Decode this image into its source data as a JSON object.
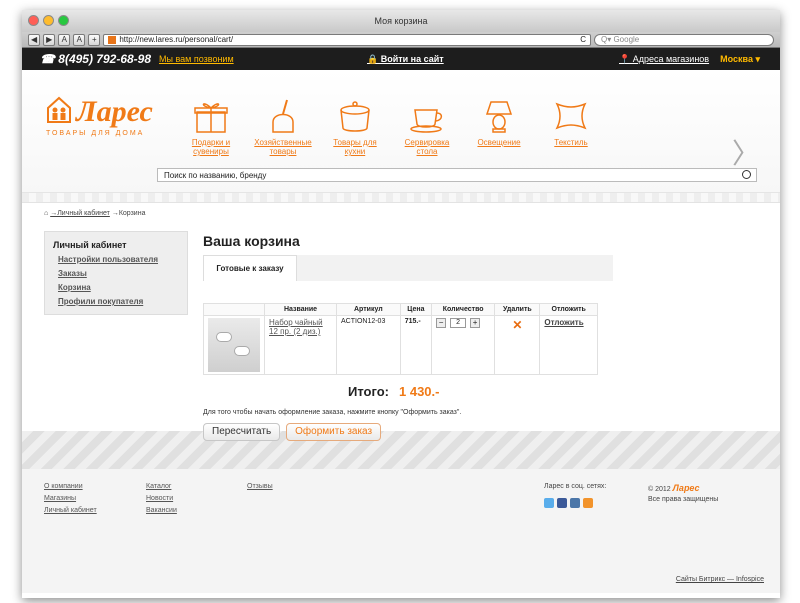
{
  "window": {
    "title": "Моя корзина"
  },
  "browser": {
    "url": "http://new.lares.ru/personal/cart/",
    "search_placeholder": "Q▾ Google",
    "font_smaller": "A",
    "font_larger": "A",
    "back": "◀",
    "forward": "▶",
    "add": "+",
    "reload": "C"
  },
  "topbar": {
    "phone": "☎ 8(495) 792-68-98",
    "callback": "Мы вам позвоним",
    "login": "🔒 Войти на сайт",
    "stores": "📍 Адреса магазинов",
    "city": "Москва ▾"
  },
  "logo": {
    "name": "Ларес",
    "subtitle": "ТОВАРЫ ДЛЯ ДОМА"
  },
  "categories": [
    {
      "label": "Подарки и сувениры",
      "icon": "gift-icon"
    },
    {
      "label": "Хозяйственные товары",
      "icon": "dustpan-icon"
    },
    {
      "label": "Товары для кухни",
      "icon": "pot-icon"
    },
    {
      "label": "Сервировка стола",
      "icon": "teacup-icon"
    },
    {
      "label": "Освещение",
      "icon": "lamp-icon"
    },
    {
      "label": "Текстиль",
      "icon": "pillow-icon"
    }
  ],
  "search": {
    "placeholder": "Поиск по названию, бренду"
  },
  "breadcrumb": [
    "⌂",
    "→Личный кабинет",
    "→Корзина"
  ],
  "sidebar": {
    "title": "Личный кабинет",
    "items": [
      "Настройки пользователя",
      "Заказы",
      "Корзина",
      "Профили покупателя"
    ]
  },
  "cart": {
    "title": "Ваша корзина",
    "tab": "Готовые к заказу",
    "columns": [
      "Название",
      "Артикул",
      "Цена",
      "Количество",
      "Удалить",
      "Отложить"
    ],
    "item": {
      "name": "Набор чайный 12 пр. (2 диз.)",
      "sku": "ACTION12-03",
      "price": "715.-",
      "quantity": "2",
      "delete": "✕",
      "defer": "Отложить"
    },
    "total_label": "Итого:",
    "total": "1 430.-",
    "note": "Для того чтобы начать оформление заказа, нажмите кнопку \"Оформить заказ\".",
    "recalc": "Пересчитать",
    "checkout": "Оформить заказ"
  },
  "footer": {
    "col1": [
      "О компании",
      "Магазины",
      "Личный кабинет"
    ],
    "col2": [
      "Каталог",
      "Новости",
      "Вакансии"
    ],
    "col3": [
      "Отзывы"
    ],
    "social_title": "Ларес в соц. сетях:",
    "social_icons": [
      "twitter-icon",
      "facebook-icon",
      "vk-icon",
      "ok-icon"
    ],
    "copyright": "© 2012",
    "copyright_brand": "Ларес",
    "rights": "Все права защищены",
    "credits": "Сайты Битрикс — Infospice"
  },
  "colors": {
    "accent": "#f07a17",
    "topbar": "#1d1d1d",
    "yellow": "#ffba00"
  }
}
